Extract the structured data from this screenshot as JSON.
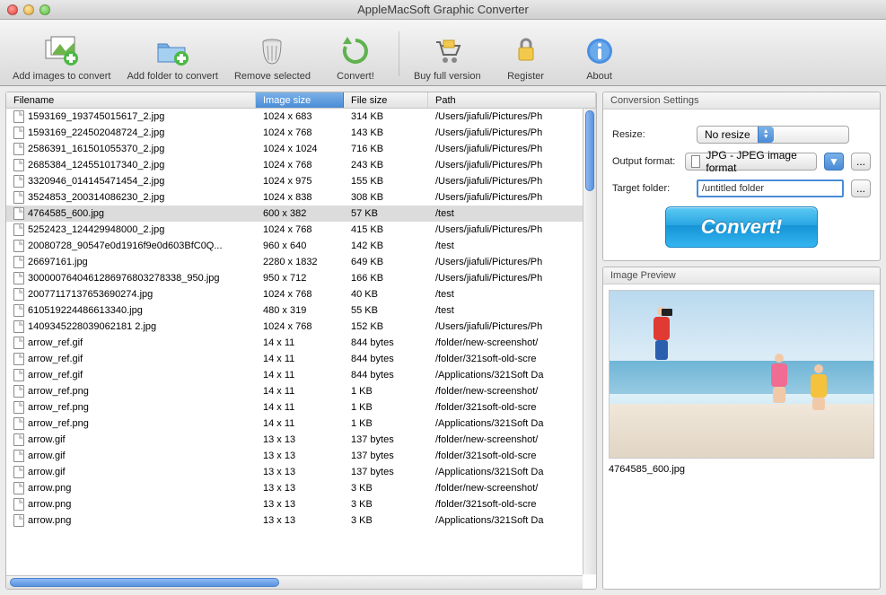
{
  "window": {
    "title": "AppleMacSoft Graphic Converter"
  },
  "toolbar": {
    "add_images": "Add images to convert",
    "add_folder": "Add folder to convert",
    "remove_selected": "Remove selected",
    "convert": "Convert!",
    "buy": "Buy full version",
    "register": "Register",
    "about": "About"
  },
  "table": {
    "headers": {
      "filename": "Filename",
      "image_size": "Image size",
      "file_size": "File size",
      "path": "Path"
    },
    "sorted_column": "image_size",
    "selected_index": 6,
    "rows": [
      {
        "filename": "1593169_193745015617_2.jpg",
        "image_size": "1024 x 683",
        "file_size": "314 KB",
        "path": "/Users/jiafuli/Pictures/Ph"
      },
      {
        "filename": "1593169_224502048724_2.jpg",
        "image_size": "1024 x 768",
        "file_size": "143 KB",
        "path": "/Users/jiafuli/Pictures/Ph"
      },
      {
        "filename": "2586391_161501055370_2.jpg",
        "image_size": "1024 x 1024",
        "file_size": "716 KB",
        "path": "/Users/jiafuli/Pictures/Ph"
      },
      {
        "filename": "2685384_124551017340_2.jpg",
        "image_size": "1024 x 768",
        "file_size": "243 KB",
        "path": "/Users/jiafuli/Pictures/Ph"
      },
      {
        "filename": "3320946_014145471454_2.jpg",
        "image_size": "1024 x 975",
        "file_size": "155 KB",
        "path": "/Users/jiafuli/Pictures/Ph"
      },
      {
        "filename": "3524853_200314086230_2.jpg",
        "image_size": "1024 x 838",
        "file_size": "308 KB",
        "path": "/Users/jiafuli/Pictures/Ph"
      },
      {
        "filename": "4764585_600.jpg",
        "image_size": "600 x 382",
        "file_size": "57 KB",
        "path": "/test"
      },
      {
        "filename": "5252423_124429948000_2.jpg",
        "image_size": "1024 x 768",
        "file_size": "415 KB",
        "path": "/Users/jiafuli/Pictures/Ph"
      },
      {
        "filename": "20080728_90547e0d1916f9e0d603BfC0Q...",
        "image_size": "960 x 640",
        "file_size": "142 KB",
        "path": "/test"
      },
      {
        "filename": "26697161.jpg",
        "image_size": "2280 x 1832",
        "file_size": "649 KB",
        "path": "/Users/jiafuli/Pictures/Ph"
      },
      {
        "filename": "3000007640461286976803278338_950.jpg",
        "image_size": "950 x 712",
        "file_size": "166 KB",
        "path": "/Users/jiafuli/Pictures/Ph"
      },
      {
        "filename": "20077117137653690274.jpg",
        "image_size": "1024 x 768",
        "file_size": "40 KB",
        "path": "/test"
      },
      {
        "filename": "610519224486613340.jpg",
        "image_size": "480 x 319",
        "file_size": "55 KB",
        "path": "/test"
      },
      {
        "filename": "1409345228039062181 2.jpg",
        "image_size": "1024 x 768",
        "file_size": "152 KB",
        "path": "/Users/jiafuli/Pictures/Ph"
      },
      {
        "filename": "arrow_ref.gif",
        "image_size": "14 x 11",
        "file_size": "844 bytes",
        "path": "/folder/new-screenshot/"
      },
      {
        "filename": "arrow_ref.gif",
        "image_size": "14 x 11",
        "file_size": "844 bytes",
        "path": "/folder/321soft-old-scre"
      },
      {
        "filename": "arrow_ref.gif",
        "image_size": "14 x 11",
        "file_size": "844 bytes",
        "path": "/Applications/321Soft Da"
      },
      {
        "filename": "arrow_ref.png",
        "image_size": "14 x 11",
        "file_size": "1 KB",
        "path": "/folder/new-screenshot/"
      },
      {
        "filename": "arrow_ref.png",
        "image_size": "14 x 11",
        "file_size": "1 KB",
        "path": "/folder/321soft-old-scre"
      },
      {
        "filename": "arrow_ref.png",
        "image_size": "14 x 11",
        "file_size": "1 KB",
        "path": "/Applications/321Soft Da"
      },
      {
        "filename": "arrow.gif",
        "image_size": "13 x 13",
        "file_size": "137 bytes",
        "path": "/folder/new-screenshot/"
      },
      {
        "filename": "arrow.gif",
        "image_size": "13 x 13",
        "file_size": "137 bytes",
        "path": "/folder/321soft-old-scre"
      },
      {
        "filename": "arrow.gif",
        "image_size": "13 x 13",
        "file_size": "137 bytes",
        "path": "/Applications/321Soft Da"
      },
      {
        "filename": "arrow.png",
        "image_size": "13 x 13",
        "file_size": "3 KB",
        "path": "/folder/new-screenshot/"
      },
      {
        "filename": "arrow.png",
        "image_size": "13 x 13",
        "file_size": "3 KB",
        "path": "/folder/321soft-old-scre"
      },
      {
        "filename": "arrow.png",
        "image_size": "13 x 13",
        "file_size": "3 KB",
        "path": "/Applications/321Soft Da"
      }
    ]
  },
  "settings": {
    "title": "Conversion Settings",
    "resize_label": "Resize:",
    "resize_value": "No resize",
    "output_format_label": "Output format:",
    "output_format_value": "JPG - JPEG image format",
    "target_folder_label": "Target folder:",
    "target_folder_value": "/untitled folder",
    "browse_label": "...",
    "convert_button": "Convert!"
  },
  "preview": {
    "title": "Image Preview",
    "filename": "4764585_600.jpg"
  }
}
